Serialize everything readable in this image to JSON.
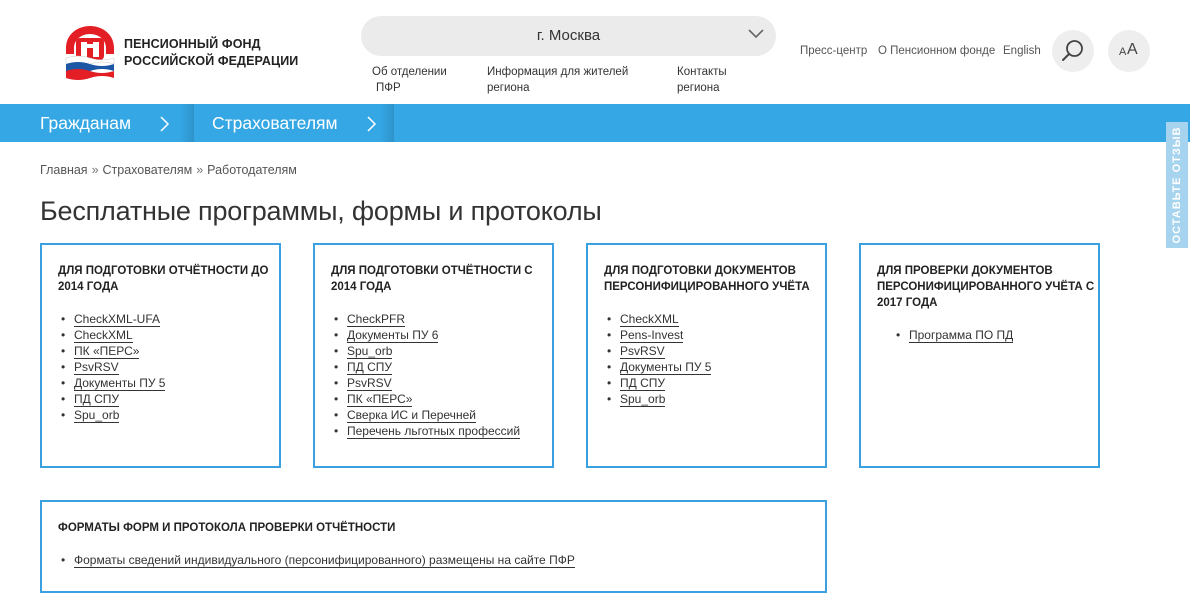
{
  "header": {
    "logo_lines": [
      "ПЕНСИОННЫЙ ФОНД",
      "РОССИЙСКОЙ ФЕДЕРАЦИИ"
    ],
    "region": "г. Москва",
    "sublinks": [
      {
        "line1": "Об отделении",
        "line2": "ПФР"
      },
      {
        "line1": "Информация для жителей",
        "line2": "региона"
      },
      {
        "line1": "Контакты",
        "line2": "региона"
      }
    ],
    "top_links": [
      "Пресс-центр",
      "О Пенсионном фонде",
      "English"
    ],
    "font_small": "A",
    "font_big": "A"
  },
  "nav": {
    "items": [
      "Гражданам",
      "Страхователям"
    ]
  },
  "feedback": "ОСТАВЬТЕ ОТЗЫВ",
  "breadcrumb": [
    "Главная",
    "Страхователям",
    "Работодателям"
  ],
  "breadcrumb_sep": "»",
  "page_title": "Бесплатные программы, формы и протоколы",
  "cards": [
    {
      "title_lines": [
        "ДЛЯ ПОДГОТОВКИ ОТЧЁТНОСТИ ДО",
        "2014 ГОДА"
      ],
      "items": [
        "CheckXML-UFA",
        "CheckXML",
        "ПК «ПЕРС»",
        "PsvRSV",
        "Документы ПУ 5",
        "ПД СПУ",
        "Spu_orb"
      ]
    },
    {
      "title_lines": [
        "ДЛЯ ПОДГОТОВКИ ОТЧЁТНОСТИ С",
        "2014 ГОДА"
      ],
      "items": [
        "CheckPFR",
        "Документы ПУ 6",
        "Spu_orb",
        "ПД СПУ",
        "PsvRSV",
        "ПК «ПЕРС»",
        "Сверка ИС и Перечней",
        "Перечень льготных профессий"
      ]
    },
    {
      "title_lines": [
        "ДЛЯ ПОДГОТОВКИ ДОКУМЕНТОВ",
        "ПЕРСОНИФИЦИРОВАННОГО УЧЁТА"
      ],
      "items": [
        "CheckXML",
        "Pens-Invest",
        "PsvRSV",
        "Документы ПУ 5",
        "ПД СПУ",
        "Spu_orb"
      ]
    },
    {
      "title_lines": [
        "ДЛЯ ПРОВЕРКИ ДОКУМЕНТОВ",
        "ПЕРСОНИФИЦИРОВАННОГО УЧЁТА С",
        "2017 ГОДА"
      ],
      "items": [
        "Программа ПО ПД"
      ]
    },
    {
      "title_lines": [
        "ФОРМАТЫ ФОРМ И ПРОТОКОЛА ПРОВЕРКИ ОТЧЁТНОСТИ"
      ],
      "items": [
        "Форматы сведений индивидуального (персонифицированного) размещены на сайте ПФР"
      ]
    }
  ],
  "colors": {
    "brand_red": "#e31e24",
    "nav_blue": "#35a7e4",
    "card_border": "#3aa0df"
  }
}
